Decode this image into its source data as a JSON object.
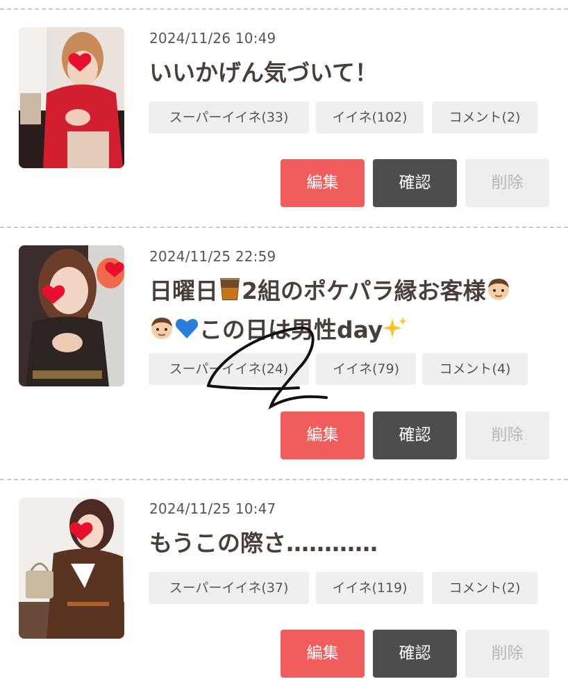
{
  "posts": [
    {
      "date": "2024/11/26 10:49",
      "title": "いいかげん気づいて！",
      "tags": {
        "super_like": "スーパーイイネ(33)",
        "like": "イイネ(102)",
        "comment": "コメント(2)"
      },
      "actions": {
        "edit": "編集",
        "confirm": "確認",
        "delete": "削除"
      }
    },
    {
      "date": "2024/11/25 22:59",
      "title_line1_a": "日曜日",
      "title_line1_b": "2組のポケパラ縁お客様",
      "title_line2": "この日は男性day",
      "tags": {
        "super_like": "スーパーイイネ(24)",
        "like": "イイネ(79)",
        "comment": "コメント(4)"
      },
      "actions": {
        "edit": "編集",
        "confirm": "確認",
        "delete": "削除"
      }
    },
    {
      "date": "2024/11/25 10:47",
      "title": "もうこの際さ…………",
      "tags": {
        "super_like": "スーパーイイネ(37)",
        "like": "イイネ(119)",
        "comment": "コメント(2)"
      },
      "actions": {
        "edit": "編集",
        "confirm": "確認",
        "delete": "削除"
      }
    }
  ],
  "colors": {
    "edit": "#ef5d5c",
    "confirm": "#4d4d4d",
    "delete": "#eeeeee",
    "tag": "#efefef",
    "title": "#4a3f38"
  },
  "emoji": [
    "whisky-glass-emoji",
    "boy-emoji",
    "blue-heart-emoji",
    "sparkles-emoji"
  ]
}
